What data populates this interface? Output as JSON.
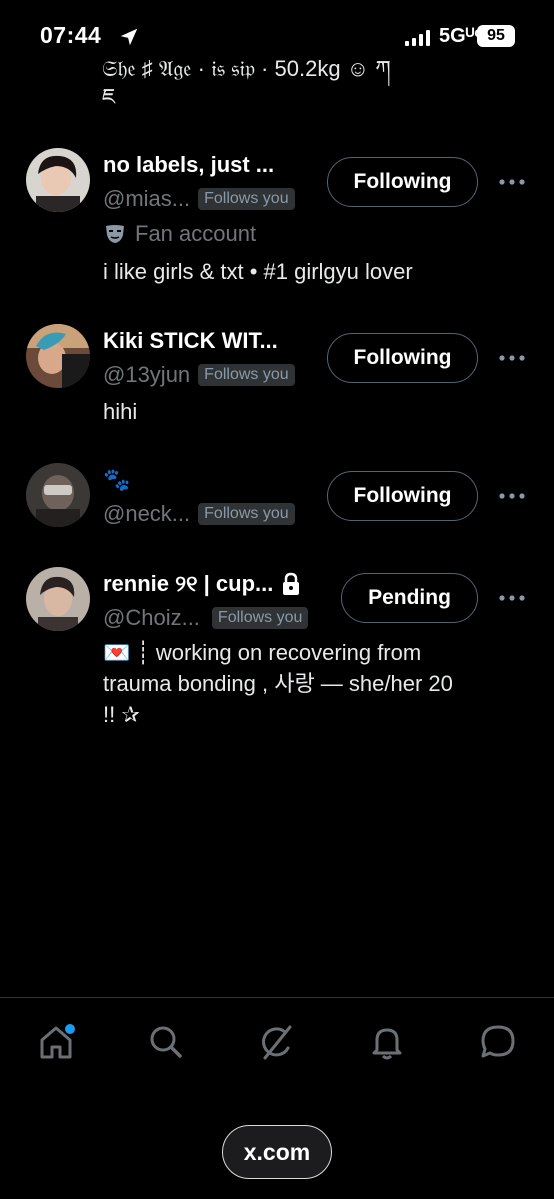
{
  "status_bar": {
    "time": "07:44",
    "network": "5Gᵁᶜ",
    "battery": "95"
  },
  "previous_bio": {
    "line1": "𝔖𝔥𝔢 ♯ 𝔄𝔤𝔢 · 𝔦𝔰 𝔰𝔦𝔭 · 50.2kg ☺ ཀ",
    "line2": "ཇ"
  },
  "users": [
    {
      "name": "no labels, just ...",
      "handle": "@mias...",
      "follows_you": "Follows you",
      "button": "Following",
      "meta_text": "Fan account",
      "bio": "i like girls & txt • #1 girlgyu lover"
    },
    {
      "name": "Kiki STICK WIT...",
      "handle": "@13yjun",
      "follows_you": "Follows you",
      "button": "Following",
      "bio": "hihi"
    },
    {
      "name": "🐾",
      "handle": "@neck...",
      "follows_you": "Follows you",
      "button": "Following"
    },
    {
      "name": "rennie ୨୧ | cup...",
      "handle": "@Choiz...",
      "follows_you": "Follows you",
      "button": "Pending",
      "bio_line1": "💌 ┊ working on recovering from",
      "bio_line2": "trauma bonding ,   사랑 — she/her 20",
      "bio_line3": "!! ✰"
    }
  ],
  "url_bar": {
    "domain": "x.com"
  },
  "nav": {
    "items": [
      "home-icon",
      "search-icon",
      "grok-icon",
      "notifications-icon",
      "messages-icon"
    ]
  },
  "colors": {
    "background": "#000000",
    "muted": "#71767b",
    "accent": "#1d9bf0"
  }
}
